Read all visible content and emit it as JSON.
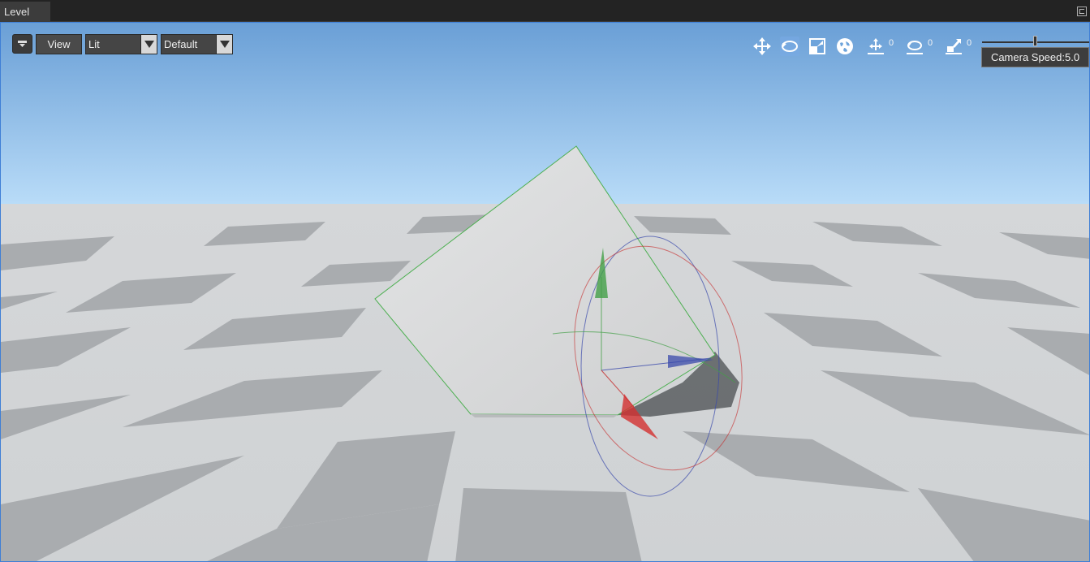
{
  "tab": {
    "title": "Level",
    "pin_glyph": "⊏"
  },
  "toolbar": {
    "view_label": "View",
    "shading_mode": "Lit",
    "layout_preset": "Default",
    "translate_snap": "0",
    "rotate_snap": "0",
    "scale_snap": "0",
    "camera_speed_label": "Camera Speed:5.0",
    "camera_speed_fraction": 0.5
  },
  "colors": {
    "selection_outline": "#4caf50",
    "gizmo_x": "#d32f2f",
    "gizmo_y": "#43a047",
    "gizmo_z": "#3949ab",
    "viewport_border": "#3f7fd6"
  },
  "icons": [
    "filter-icon",
    "translate-icon",
    "rotate-icon",
    "scale-icon",
    "world-space-icon",
    "translate-snap-icon",
    "rotate-snap-icon",
    "scale-snap-icon"
  ]
}
